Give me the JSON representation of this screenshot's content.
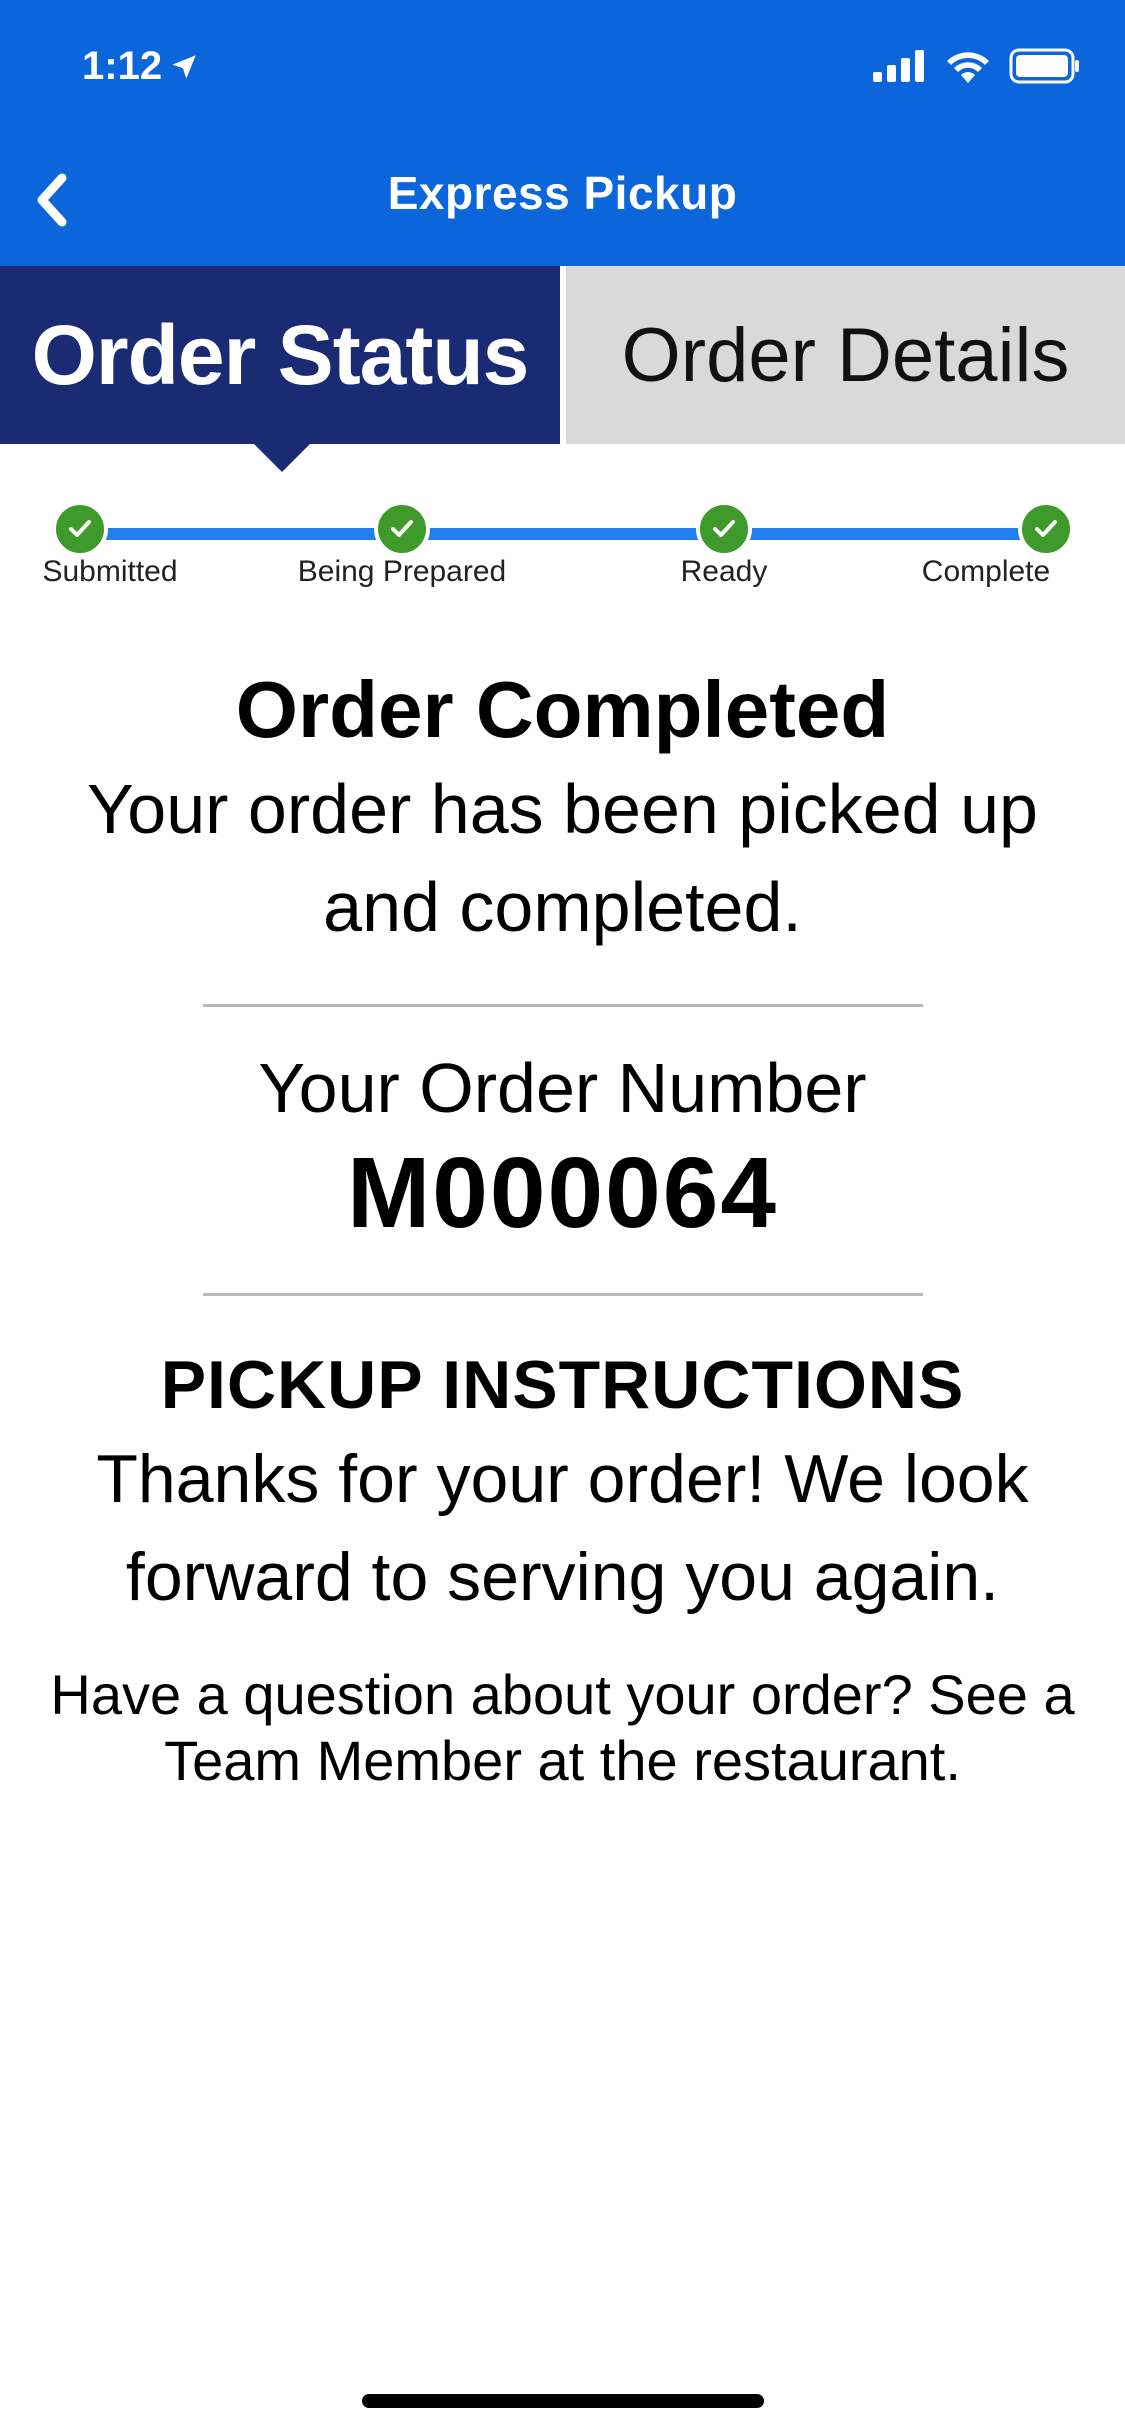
{
  "status_bar": {
    "time": "1:12",
    "icons": [
      "location-arrow-icon",
      "cellular-signal-icon",
      "wifi-icon",
      "battery-icon"
    ]
  },
  "nav": {
    "title": "Express Pickup",
    "back_icon": "chevron-left-icon"
  },
  "tabs": [
    {
      "label": "Order Status",
      "active": true
    },
    {
      "label": "Order Details",
      "active": false
    }
  ],
  "progress": {
    "steps": [
      {
        "label": "Submitted",
        "done": true
      },
      {
        "label": "Being Prepared",
        "done": true
      },
      {
        "label": "Ready",
        "done": true
      },
      {
        "label": "Complete",
        "done": true
      }
    ]
  },
  "status": {
    "title": "Order Completed",
    "message": "Your order has been picked up and completed."
  },
  "order": {
    "label": "Your Order Number",
    "number": "M000064"
  },
  "pickup": {
    "heading": "PICKUP INSTRUCTIONS",
    "message": "Thanks for your order! We look forward to serving you again.",
    "question": "Have a question about your order? See a Team Member at the restaurant."
  },
  "colors": {
    "header_blue": "#0b66dc",
    "active_tab_navy": "#1a2a73",
    "inactive_tab_gray": "#d9d9d9",
    "progress_blue": "#1f7ff0",
    "check_green": "#3d9a2b"
  }
}
